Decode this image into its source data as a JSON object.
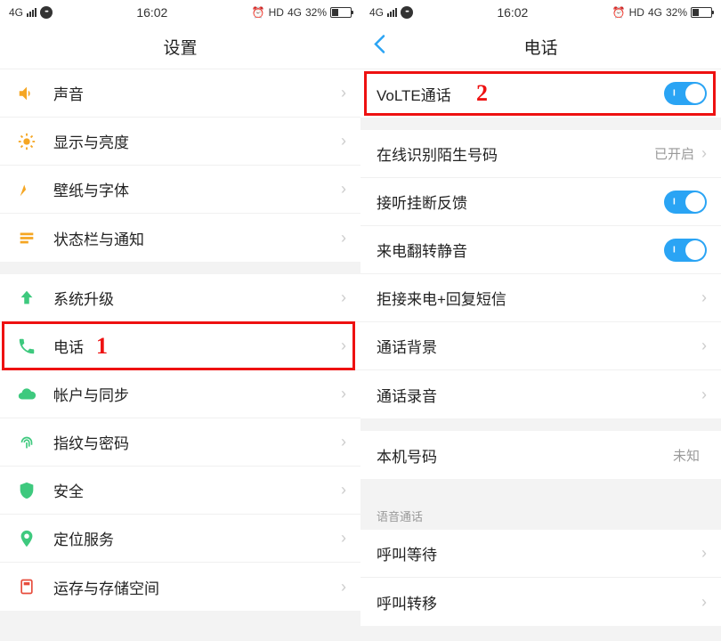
{
  "status": {
    "network": "4G",
    "time": "16:02",
    "hd": "HD",
    "net_type": "4G",
    "battery_pct": "32%"
  },
  "left": {
    "title": "设置",
    "annotation": "1",
    "groups": [
      [
        {
          "icon": "sound",
          "label": "声音"
        },
        {
          "icon": "brightness",
          "label": "显示与亮度"
        },
        {
          "icon": "wallpaper",
          "label": "壁纸与字体"
        },
        {
          "icon": "notification",
          "label": "状态栏与通知"
        }
      ],
      [
        {
          "icon": "upgrade",
          "label": "系统升级"
        },
        {
          "icon": "phone",
          "label": "电话",
          "highlight": true
        },
        {
          "icon": "cloud",
          "label": "帐户与同步"
        },
        {
          "icon": "fingerprint",
          "label": "指纹与密码"
        },
        {
          "icon": "security",
          "label": "安全"
        },
        {
          "icon": "location",
          "label": "定位服务"
        },
        {
          "icon": "storage",
          "label": "运存与存储空间"
        }
      ]
    ]
  },
  "right": {
    "title": "电话",
    "annotation": "2",
    "sections": [
      {
        "rows": [
          {
            "label": "VoLTE通话",
            "type": "toggle",
            "on": true,
            "highlight": true
          }
        ]
      },
      {
        "rows": [
          {
            "label": "在线识别陌生号码",
            "type": "value",
            "value": "已开启"
          },
          {
            "label": "接听挂断反馈",
            "type": "toggle",
            "on": true
          },
          {
            "label": "来电翻转静音",
            "type": "toggle",
            "on": true
          },
          {
            "label": "拒接来电+回复短信",
            "type": "nav"
          },
          {
            "label": "通话背景",
            "type": "nav"
          },
          {
            "label": "通话录音",
            "type": "nav"
          }
        ]
      },
      {
        "rows": [
          {
            "label": "本机号码",
            "type": "value",
            "value": "未知"
          }
        ]
      },
      {
        "header": "语音通话",
        "rows": [
          {
            "label": "呼叫等待",
            "type": "nav"
          },
          {
            "label": "呼叫转移",
            "type": "nav"
          }
        ]
      }
    ]
  }
}
